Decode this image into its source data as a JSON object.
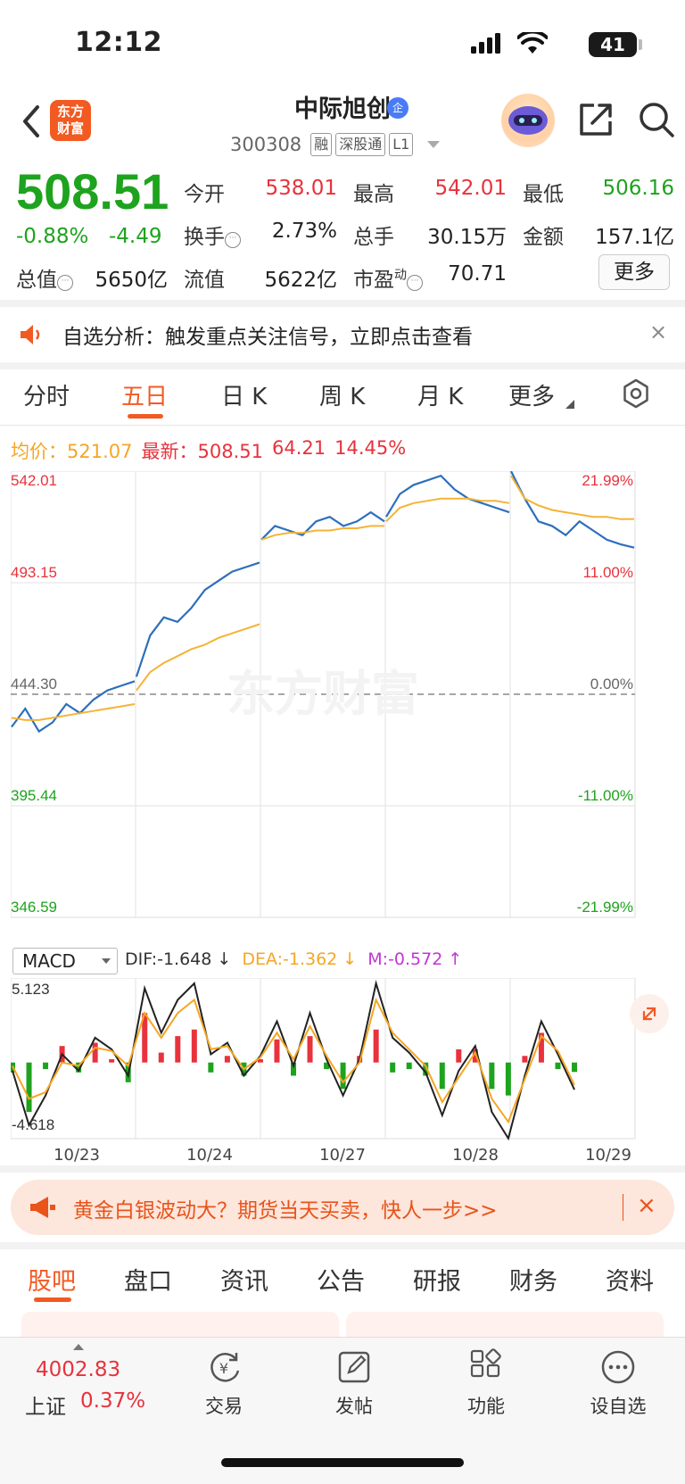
{
  "status_bar": {
    "time": "12:12",
    "battery": "41"
  },
  "header": {
    "stock_name": "中际旭创",
    "badge": "企",
    "code": "300308",
    "tags": [
      "融",
      "深股通",
      "L1"
    ],
    "logo_text": [
      "东方",
      "财富"
    ]
  },
  "quote": {
    "price": "508.51",
    "change_pct": "-0.88%",
    "change_amt": "-4.49",
    "open_label": "今开",
    "open": "538.01",
    "high_label": "最高",
    "high": "542.01",
    "low_label": "最低",
    "low": "506.16",
    "turnover_label": "换手",
    "turnover": "2.73%",
    "volume_label": "总手",
    "volume": "30.15万",
    "amount_label": "金额",
    "amount": "157.1亿",
    "mktcap_label": "总值",
    "mktcap": "5650亿",
    "float_label": "流值",
    "float": "5622亿",
    "pe_label": "市盈",
    "pe_super": "动",
    "pe": "70.71",
    "more_label": "更多"
  },
  "notice": {
    "text": "自选分析：触发重点关注信号，立即点击查看",
    "close": "×"
  },
  "period_tabs": [
    "分时",
    "五日",
    "日 K",
    "周 K",
    "月 K",
    "更多"
  ],
  "active_period": "五日",
  "avg_line": {
    "avg_label": "均价：",
    "avg": "521.07",
    "latest_label": "最新：",
    "latest": "508.51",
    "chg": "64.21",
    "chg_pct": "14.45%"
  },
  "colors": {
    "accent": "#f25a22",
    "up": "#e8323c",
    "down": "#1ea31e",
    "price_line": "#2d6fbd",
    "avg_line": "#f5b335",
    "macd_dea": "#f5a623",
    "macd_m": "#c435d6"
  },
  "chart_data": [
    {
      "type": "line",
      "title": "",
      "x": [
        "10/23",
        "10/24",
        "10/27",
        "10/28",
        "10/29"
      ],
      "y_axis_left": [
        "542.01",
        "493.15",
        "444.30",
        "395.44",
        "346.59"
      ],
      "y_axis_right": [
        "21.99%",
        "11.00%",
        "0.00%",
        "-11.00%",
        "-21.99%"
      ],
      "ylim": [
        346.59,
        542.01
      ],
      "prev_close": 444.3,
      "watermark": "东方财富",
      "series": [
        {
          "name": "最新",
          "color": "price_line",
          "values": [
            [
              430,
              438,
              428,
              432,
              440,
              436,
              442,
              446,
              448,
              450
            ],
            [
              452,
              470,
              478,
              476,
              482,
              490,
              494,
              498,
              500,
              502
            ],
            [
              512,
              518,
              516,
              514,
              520,
              522,
              518,
              520,
              524,
              520
            ],
            [
              522,
              532,
              536,
              538,
              540,
              534,
              530,
              528,
              526,
              524
            ],
            [
              542,
              530,
              520,
              518,
              514,
              520,
              516,
              512,
              510,
              508.51
            ]
          ]
        },
        {
          "name": "均价",
          "color": "avg_line",
          "values": [
            [
              434,
              433,
              433,
              434,
              435,
              436,
              437,
              438,
              439,
              440
            ],
            [
              446,
              454,
              458,
              461,
              464,
              466,
              469,
              471,
              473,
              475
            ],
            [
              512,
              514,
              515,
              515,
              516,
              516,
              517,
              517,
              518,
              518
            ],
            [
              520,
              526,
              528,
              529,
              530,
              530,
              530,
              529,
              529,
              528
            ],
            [
              540,
              530,
              527,
              525,
              524,
              523,
              522,
              522,
              521,
              521.07
            ]
          ]
        }
      ]
    },
    {
      "type": "line",
      "title": "MACD",
      "indicator_select": "MACD",
      "dif_label": "DIF:-1.648 ↓",
      "dea_label": "DEA:-1.362 ↓",
      "m_label": "M:-0.572 ↑",
      "ylim": [
        -4.618,
        5.123
      ],
      "y_axis_labels": [
        "5.123",
        "-4.618"
      ],
      "series": [
        {
          "name": "DIF",
          "values": [
            -0.5,
            -3.8,
            -2.0,
            0.5,
            -0.5,
            1.5,
            0.8,
            -0.8,
            4.5,
            1.8,
            3.8,
            4.8,
            0.5,
            1.2,
            -0.8,
            0.4,
            2.5,
            -0.2,
            3.0,
            0.2,
            -2.0,
            0.2,
            4.8,
            1.5,
            0.6,
            -0.6,
            -3.2,
            -0.5,
            1.0,
            -3.0,
            -4.6,
            -0.8,
            2.5,
            0.5,
            -1.648
          ]
        },
        {
          "name": "DEA",
          "values": [
            -0.2,
            -2.2,
            -1.8,
            0.0,
            -0.2,
            0.9,
            0.7,
            -0.2,
            3.0,
            1.5,
            3.0,
            3.8,
            0.8,
            1.0,
            -0.4,
            0.3,
            1.8,
            0.2,
            2.2,
            0.4,
            -1.2,
            0.0,
            3.8,
            1.8,
            0.8,
            -0.2,
            -2.4,
            -0.9,
            0.6,
            -2.2,
            -3.6,
            -1.0,
            1.6,
            0.7,
            -1.362
          ]
        },
        {
          "name": "M",
          "values": [
            -0.6,
            -3.0,
            -0.4,
            1.0,
            -0.6,
            1.2,
            0.2,
            -1.2,
            3.0,
            0.6,
            1.6,
            2.0,
            -0.6,
            0.4,
            -0.8,
            0.2,
            1.4,
            -0.8,
            1.6,
            -0.4,
            -1.6,
            0.4,
            2.0,
            -0.6,
            -0.4,
            -0.8,
            -1.6,
            0.8,
            0.8,
            -1.6,
            -2.0,
            0.4,
            1.8,
            -0.4,
            -0.572
          ]
        }
      ]
    }
  ],
  "promo": {
    "text": "黄金白银波动大？期货当天买卖，快人一步>>",
    "close": "×"
  },
  "content_tabs": [
    "股吧",
    "盘口",
    "资讯",
    "公告",
    "研报",
    "财务",
    "资料"
  ],
  "bottom_nav": {
    "index_value": "4002.83",
    "index_name": "上证",
    "index_pct": "0.37%",
    "items": [
      "交易",
      "发帖",
      "功能",
      "设自选"
    ],
    "trade_icon_glyph": "¥"
  }
}
